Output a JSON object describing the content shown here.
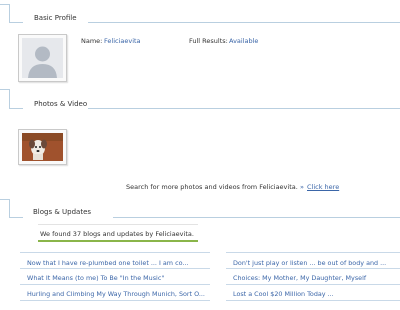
{
  "basic_profile": {
    "title": "Basic Profile",
    "name_label": "Name:",
    "name_value": "Feliciaevita",
    "full_results_label": "Full Results:",
    "full_results_value": "Available"
  },
  "photos_video": {
    "title": "Photos & Video",
    "search_text": "Search for more photos and videos from Feliciaevita.",
    "arrow": "»",
    "click_here": "Click here"
  },
  "blogs": {
    "title": "Blogs & Updates",
    "summary": "We found 37 blogs and updates by Feliciaevita.",
    "left_items": [
      "Now that I have re-plumbed one toilet ... I am co...",
      "What It Means (to me) To Be \"In the Music\"",
      "Hurling and Climbing My Way Through Munich, Sort O..."
    ],
    "right_items": [
      "Don't just play or listen ... be out of body and ...",
      "Choices: My Mother, My Daughter, Myself",
      "Lost a Cool $20 Million Today ..."
    ]
  },
  "colors": {
    "link": "#3b66a8",
    "rule": "#b9cfe0",
    "summary_underline": "#8ab54a"
  }
}
